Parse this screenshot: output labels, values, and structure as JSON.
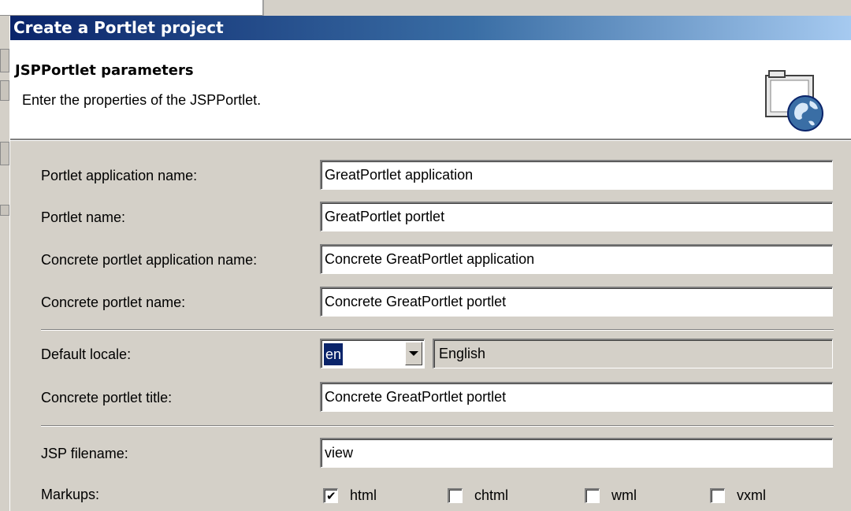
{
  "window": {
    "title": "Create a Portlet project"
  },
  "header": {
    "title": "JSPPortlet parameters",
    "description": "Enter the properties of the JSPPortlet."
  },
  "fields": {
    "app_name": {
      "label": "Portlet application name:",
      "value": "GreatPortlet application"
    },
    "portlet_name": {
      "label": "Portlet name:",
      "value": "GreatPortlet portlet"
    },
    "concrete_app_name": {
      "label": "Concrete portlet application name:",
      "value": "Concrete GreatPortlet application"
    },
    "concrete_portlet_name": {
      "label": "Concrete portlet name:",
      "value": "Concrete GreatPortlet portlet"
    },
    "default_locale": {
      "label": "Default locale:",
      "value": "en",
      "language": "English"
    },
    "concrete_title": {
      "label": "Concrete portlet title:",
      "value": "Concrete GreatPortlet portlet"
    },
    "jsp_filename": {
      "label": "JSP filename:",
      "value": "view"
    },
    "markups": {
      "label": "Markups:",
      "options": [
        {
          "label": "html",
          "checked": true
        },
        {
          "label": "chtml",
          "checked": false
        },
        {
          "label": "wml",
          "checked": false
        },
        {
          "label": "vxml",
          "checked": false
        }
      ]
    }
  },
  "icons": {
    "header_icon": "portlet-project-globe-icon",
    "dropdown_icon": "chevron-down-icon",
    "check_icon": "checkmark-icon"
  },
  "colors": {
    "titlebar_start": "#0a246a",
    "titlebar_end": "#a6caf0",
    "dialog_bg": "#d4d0c8",
    "selection": "#0a246a"
  }
}
